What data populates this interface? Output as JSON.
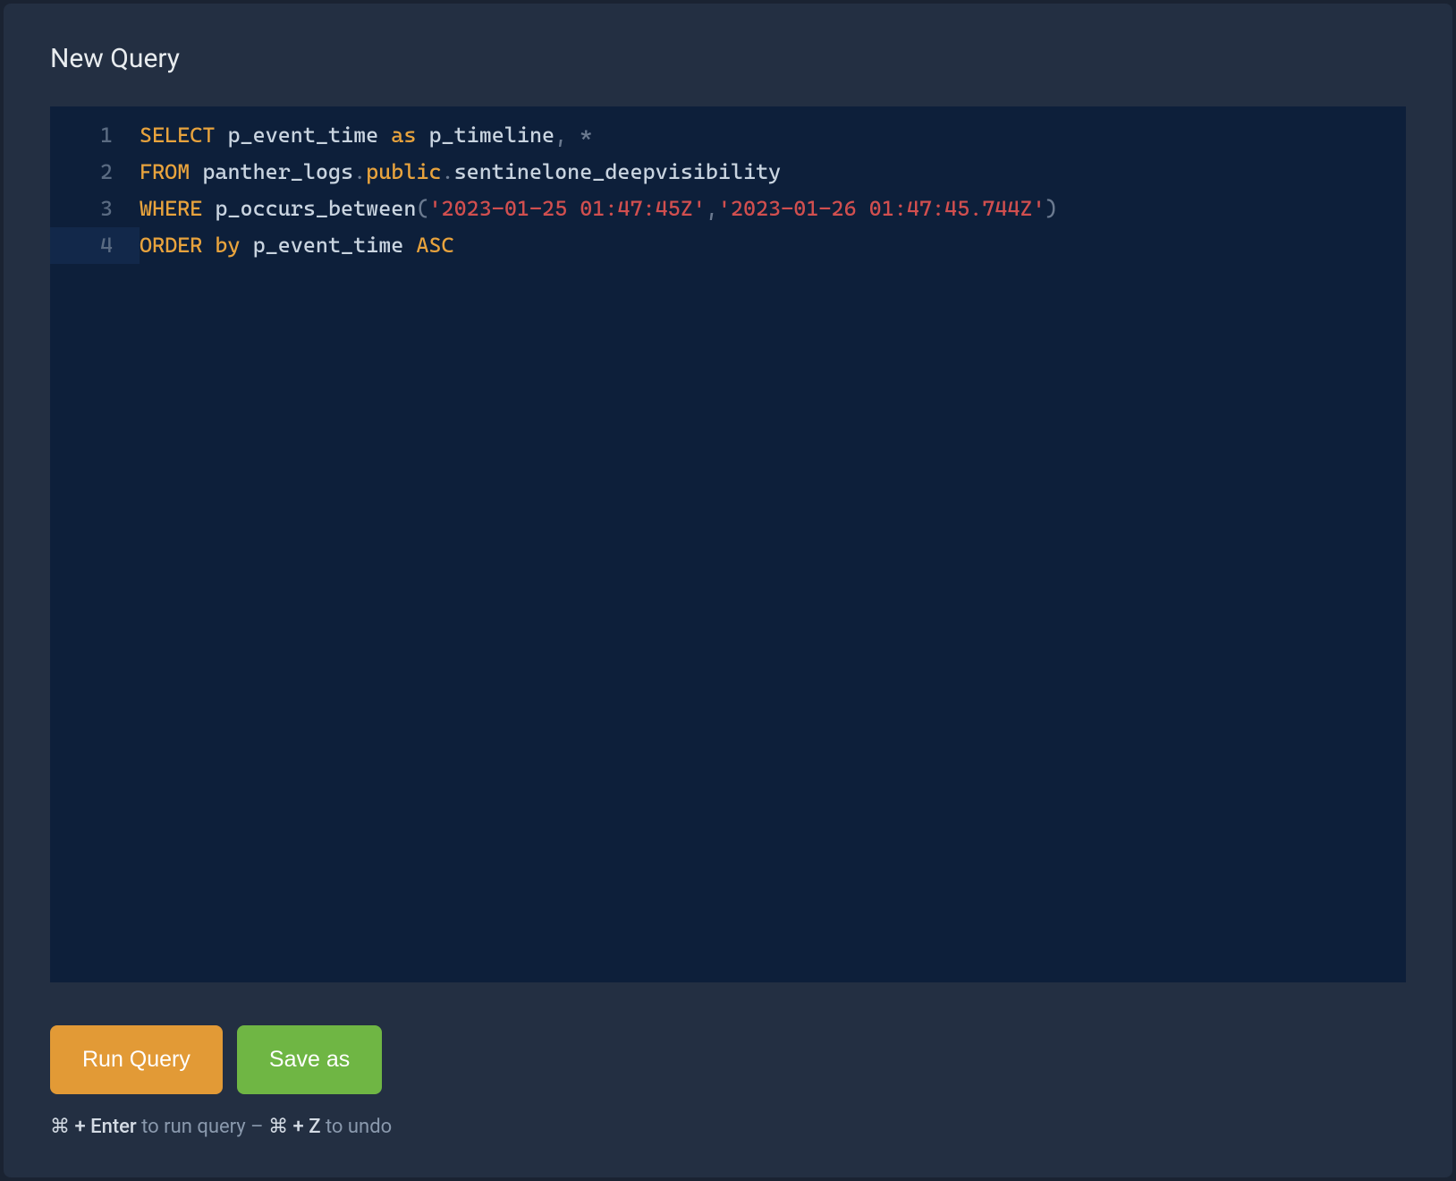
{
  "title": "New Query",
  "editor": {
    "line1": {
      "n": "1",
      "t1": "SELECT",
      "t2": " p_event_time ",
      "t3": "as",
      "t4": " p_timeline",
      "t5": ", ",
      "t6": "*"
    },
    "line2": {
      "n": "2",
      "t1": "FROM",
      "t2": " panther_logs",
      "t3": ".",
      "t4": "public",
      "t5": ".",
      "t6": "sentinelone_deepvisibility"
    },
    "line3": {
      "n": "3",
      "t1": "WHERE",
      "t2": " p_occurs_between",
      "t3": "(",
      "t4": "'2023-01-25 01:47:45Z'",
      "t5": ",",
      "t6": "'2023-01-26 01:47:45.744Z'",
      "t7": ")"
    },
    "line4": {
      "n": "4",
      "t1": "ORDER",
      "t2": " ",
      "t3": "by",
      "t4": " p_event_time ",
      "t5": "ASC"
    }
  },
  "buttons": {
    "run": "Run Query",
    "save": "Save as"
  },
  "hint": {
    "s1": "⌘ + Enter",
    "s2": " to run query – ",
    "s3": "⌘ + Z",
    "s4": " to undo"
  }
}
